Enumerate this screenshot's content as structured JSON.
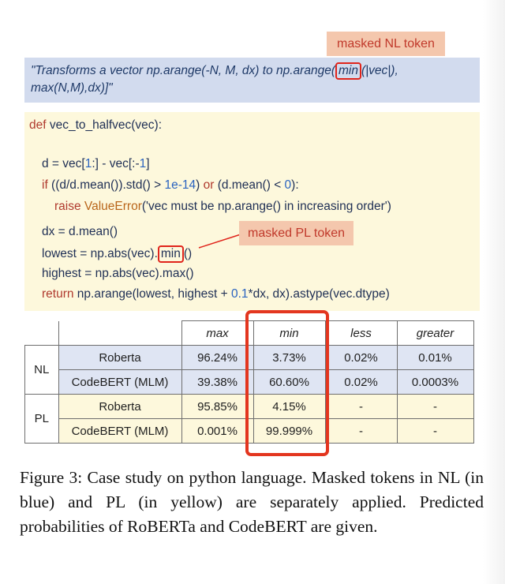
{
  "nl_token_label": "masked NL token",
  "pl_token_label": "masked PL token",
  "docstring": {
    "before": "\"Transforms a vector np.arange(-N, M, dx) to np.arange(",
    "masked": "min",
    "after": "(|vec|), max(N,M),dx)]\""
  },
  "code": {
    "l1_kw": "def",
    "l1_rest": " vec_to_halfvec(vec):",
    "l2_a": "d = vec[",
    "l2_n1": "1",
    "l2_b": ":] - vec[:-",
    "l2_n2": "1",
    "l2_c": "]",
    "l3_kw1": "if",
    "l3_a": " ((d/d.mean()).std() > ",
    "l3_n1": "1e-14",
    "l3_b": ") ",
    "l3_kw2": "or",
    "l3_c": " (d.mean() < ",
    "l3_n2": "0",
    "l3_d": "):",
    "l4_kw": "raise",
    "l4_err": " ValueError",
    "l4_rest": "('vec must be np.arange() in increasing order')",
    "l5": "dx = d.mean()",
    "l6_a": "lowest = np.abs(vec).",
    "l6_masked": "min",
    "l6_b": "()",
    "l7": "highest = np.abs(vec).max()",
    "l8_kw": "return",
    "l8_a": " np.arange(lowest, highest + ",
    "l8_n": "0.1",
    "l8_b": "*dx, dx).astype(vec.dtype)"
  },
  "table": {
    "headers": [
      "max",
      "min",
      "less",
      "greater"
    ],
    "groups": [
      {
        "name": "NL",
        "rows": [
          {
            "model": "Roberta",
            "values": [
              "96.24%",
              "3.73%",
              "0.02%",
              "0.01%"
            ]
          },
          {
            "model": "CodeBERT (MLM)",
            "values": [
              "39.38%",
              "60.60%",
              "0.02%",
              "0.0003%"
            ]
          }
        ]
      },
      {
        "name": "PL",
        "rows": [
          {
            "model": "Roberta",
            "values": [
              "95.85%",
              "4.15%",
              "-",
              "-"
            ]
          },
          {
            "model": "CodeBERT (MLM)",
            "values": [
              "0.001%",
              "99.999%",
              "-",
              "-"
            ]
          }
        ]
      }
    ]
  },
  "caption": "Figure 3: Case study on python language. Masked tokens in NL (in blue) and PL (in yellow) are separately applied. Predicted probabilities of RoBERTa and CodeBERT are given.",
  "colors": {
    "nl_bg": "#d2dbee",
    "pl_bg": "#fdf8dc",
    "tag_bg": "#f4c7ad",
    "highlight_red": "#e0241b"
  }
}
